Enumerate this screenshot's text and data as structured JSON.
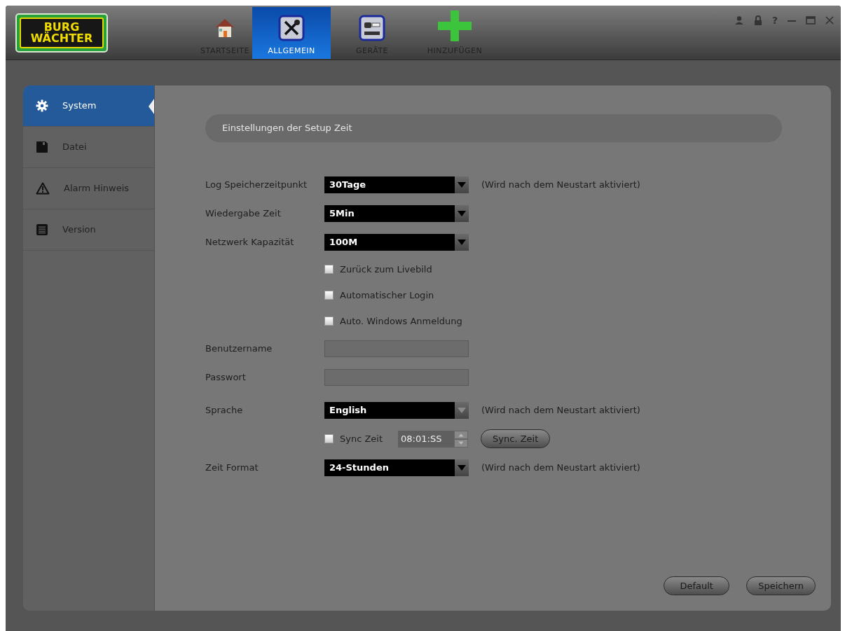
{
  "logo": {
    "line_1": "BURG",
    "line_2": "WÄCHTER"
  },
  "nav_tabs": [
    {
      "label": "STARTSEITE",
      "kind": "house",
      "selected": false
    },
    {
      "label": "ALLGEMEIN",
      "kind": "tools",
      "selected": true
    },
    {
      "label": "GERÄTE",
      "kind": "device",
      "selected": false
    },
    {
      "label": "HINZUFÜGEN",
      "kind": "plus",
      "selected": false
    }
  ],
  "window_controls": [
    {
      "kind": "user"
    },
    {
      "kind": "lock"
    },
    {
      "kind": "help",
      "label": "?"
    },
    {
      "kind": "minimize"
    },
    {
      "kind": "maximize"
    },
    {
      "kind": "close"
    }
  ],
  "sidebar": {
    "items": [
      {
        "label": "System",
        "kind": "gear",
        "selected": true
      },
      {
        "label": "Datei",
        "kind": "floppy",
        "selected": false
      },
      {
        "label": "Alarm Hinweis",
        "kind": "warning",
        "selected": false
      },
      {
        "label": "Version",
        "kind": "list",
        "selected": false
      }
    ]
  },
  "section_header": "Einstellungen der Setup Zeit",
  "form": [
    {
      "kind": "select",
      "label": "Log Speicherzeitpunkt",
      "value": "30Tage",
      "disabled": false,
      "note": "(Wird nach dem Neustart aktiviert)"
    },
    {
      "kind": "select",
      "label": "Wiedergabe Zeit",
      "value": "5Min",
      "disabled": false
    },
    {
      "kind": "select",
      "label": "Netzwerk Kapazität",
      "value": "100M",
      "disabled": false
    },
    {
      "kind": "checkbox",
      "label": "Zurück zum Livebild",
      "checked": false
    },
    {
      "kind": "checkbox",
      "label": "Automatischer Login",
      "checked": false
    },
    {
      "kind": "checkbox",
      "label": "Auto. Windows Anmeldung",
      "checked": false
    },
    {
      "kind": "input",
      "label": "Benutzername"
    },
    {
      "kind": "input",
      "label": "Passwort"
    },
    {
      "kind": "select",
      "label": "Sprache",
      "value": "English",
      "disabled": true,
      "note": "(Wird nach dem Neustart aktiviert)"
    },
    {
      "kind": "sync",
      "label": "Sync Zeit",
      "checked": false,
      "time": "08:01:SS",
      "button": "Sync. Zeit"
    },
    {
      "kind": "select",
      "label": "Zeit Format",
      "value": "24-Stunden",
      "disabled": false,
      "note": "(Wird nach dem Neustart aktiviert)"
    }
  ],
  "buttons": [
    "Default",
    "Speichern"
  ]
}
